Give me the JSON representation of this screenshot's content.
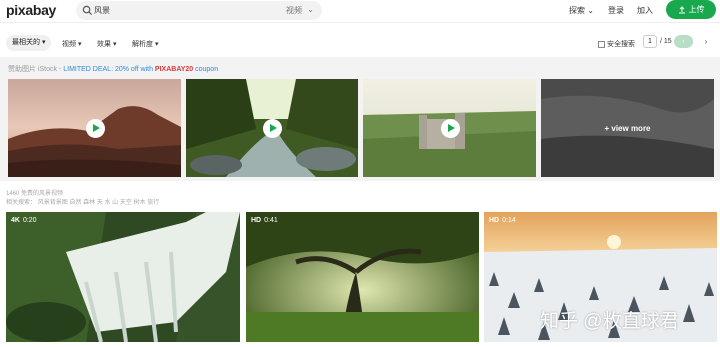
{
  "header": {
    "logo": "pixabay",
    "search_query": "风景",
    "search_type": "视频",
    "explore": "探索",
    "login": "登录",
    "join": "加入",
    "upload": "上传"
  },
  "filters": {
    "sort": "最相关的",
    "items": [
      "视频",
      "效果",
      "解析度"
    ],
    "safe_search": "安全搜索",
    "page_current": "1",
    "page_total": "/ 15"
  },
  "sponsored": {
    "label": "赞助图片 iStock - ",
    "deal": "LIMITED DEAL: 20% off with ",
    "code": "PIXABAY20",
    "suffix": " coupon",
    "view_more": "+ view more"
  },
  "results": {
    "count_text": "1460 免费的风景视频",
    "related_label": "相关搜索：",
    "related": [
      "风景背景图",
      "自然",
      "森林",
      "天",
      "水",
      "山",
      "天空",
      "树木",
      "旅行"
    ]
  },
  "videos": [
    {
      "quality": "4K",
      "duration": "0:20"
    },
    {
      "quality": "HD",
      "duration": "0:41"
    },
    {
      "quality": "HD",
      "duration": "0:14"
    }
  ],
  "watermark": "知乎 @敉直球君",
  "colors": {
    "brand": "#1aa84f",
    "deal": "#2e8bd8",
    "code": "#d93a3a"
  }
}
